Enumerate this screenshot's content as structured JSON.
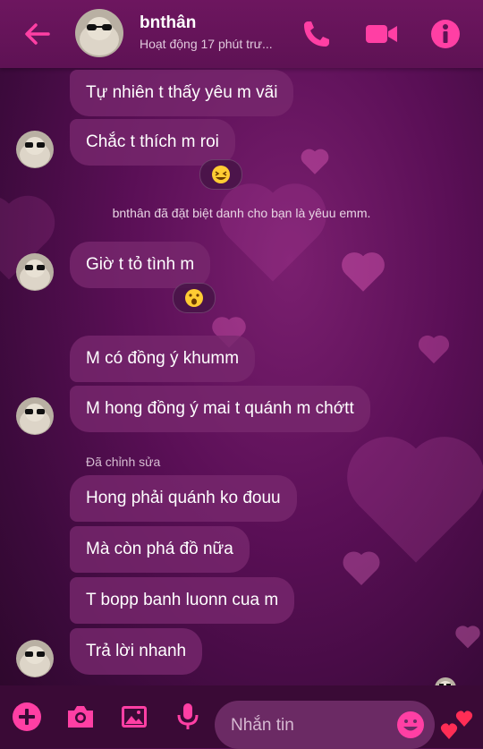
{
  "header": {
    "name": "bnthân",
    "status": "Hoạt động 17 phút trư...",
    "accent_color": "#ff3fa4"
  },
  "messages": [
    {
      "text": "Tự nhiên t thấy yêu m vãi"
    },
    {
      "text": "Chắc t thích m roi",
      "reaction": "😆"
    },
    {
      "text": "Giờ t tỏ tình m",
      "reaction": "😮"
    },
    {
      "text": "M có đồng ý khumm"
    },
    {
      "text": "M hong đồng ý mai t quánh m chớtt"
    },
    {
      "text": "Hong phải quánh ko đouu"
    },
    {
      "text": "Mà còn phá đồ nữa"
    },
    {
      "text": "T bopp banh luonn cua m"
    },
    {
      "text": "Trả lời nhanh"
    }
  ],
  "system_note": "bnthân đã đặt biệt danh cho bạn là yêuu emm.",
  "edited_label": "Đã chỉnh sửa",
  "composer": {
    "placeholder": "Nhắn tin",
    "icons": [
      "plus-icon",
      "camera-icon",
      "image-icon",
      "mic-icon",
      "emoji-icon",
      "hearts-icon"
    ]
  }
}
